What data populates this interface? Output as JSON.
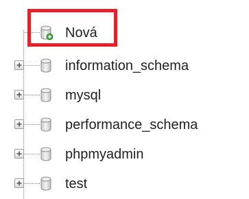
{
  "tree": {
    "new_item": {
      "label": "Nová",
      "icon": "database-add-icon"
    },
    "databases": [
      {
        "label": "information_schema",
        "icon": "database-icon",
        "expander": "plus-icon"
      },
      {
        "label": "mysql",
        "icon": "database-icon",
        "expander": "plus-icon"
      },
      {
        "label": "performance_schema",
        "icon": "database-icon",
        "expander": "plus-icon"
      },
      {
        "label": "phpmyadmin",
        "icon": "database-icon",
        "expander": "plus-icon"
      },
      {
        "label": "test",
        "icon": "database-icon",
        "expander": "plus-icon"
      }
    ]
  },
  "colors": {
    "highlight_border": "#e8202a",
    "text": "#1f1f1f",
    "add_badge": "#3ea83e"
  }
}
